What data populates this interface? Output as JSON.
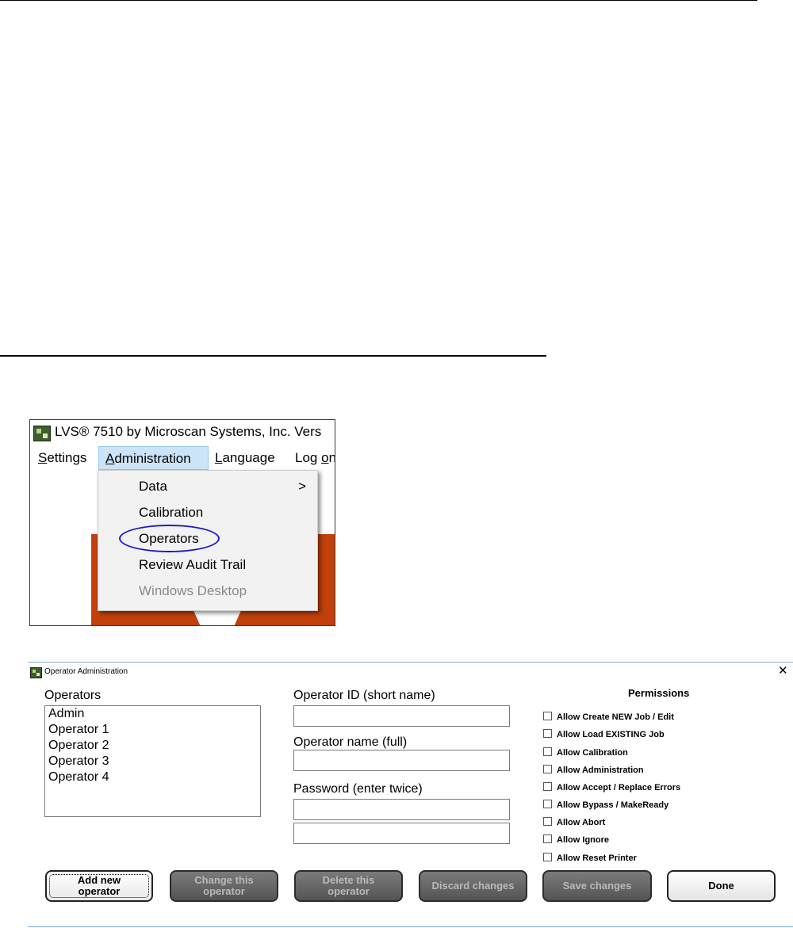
{
  "menu_screenshot": {
    "title": "LVS® 7510 by Microscan Systems, Inc.   Vers",
    "menubar": [
      {
        "label": "Settings",
        "underline_char": "S",
        "rest": "ettings"
      },
      {
        "label": "Administration",
        "underline_char": "A",
        "rest": "dministration"
      },
      {
        "label": "Language",
        "underline_char": "L",
        "rest": "anguage"
      },
      {
        "label": "Log on",
        "pre": "Log ",
        "underline_char": "o",
        "rest": "n"
      }
    ],
    "dropdown": {
      "items": [
        {
          "label": "Data",
          "submenu_arrow": ">"
        },
        {
          "label": "Calibration"
        },
        {
          "label": "Operators"
        },
        {
          "label": "Review Audit Trail"
        },
        {
          "label": "Windows Desktop",
          "disabled": true
        }
      ]
    },
    "highlight_color": "#1c1cc8",
    "accent_bg": "#c1400c"
  },
  "dialog": {
    "title": "Operator Administration",
    "close_glyph": "✕",
    "operators_label": "Operators",
    "operators": [
      "Admin",
      "Operator 1",
      "Operator 2",
      "Operator 3",
      "Operator 4"
    ],
    "operator_id_label": "Operator ID (short name)",
    "operator_name_label": "Operator name (full)",
    "password_label": "Password (enter twice)",
    "operator_id_value": "",
    "operator_name_value": "",
    "password_value": "",
    "password_confirm_value": "",
    "permissions_title": "Permissions",
    "permissions": [
      "Allow Create NEW Job / Edit",
      "Allow Load EXISTING Job",
      "Allow Calibration",
      "Allow Administration",
      "Allow Accept / Replace Errors",
      "Allow Bypass / MakeReady",
      "Allow Abort",
      "Allow Ignore",
      "Allow Reset Printer"
    ],
    "buttons": {
      "add": "Add new\noperator",
      "change": "Change this\noperator",
      "delete": "Delete this\noperator",
      "discard": "Discard changes",
      "save": "Save changes",
      "done": "Done"
    }
  }
}
